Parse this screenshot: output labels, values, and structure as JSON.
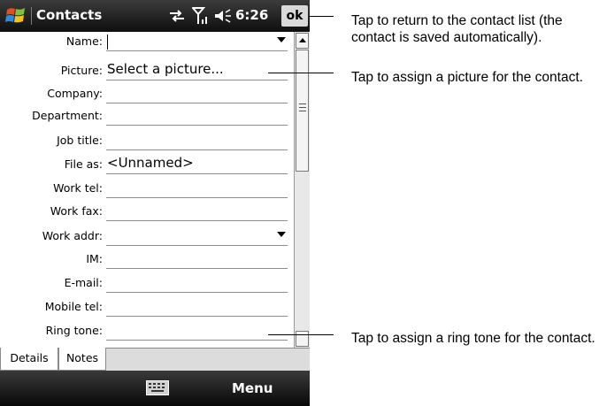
{
  "status_bar": {
    "app_title": "Contacts",
    "clock": "6:26",
    "ok_label": "ok",
    "icons": [
      "windows-start-icon",
      "connectivity-icon",
      "signal-icon",
      "volume-icon"
    ]
  },
  "form": {
    "fields": [
      {
        "label": "Name:",
        "value": "",
        "dropdown": true
      },
      {
        "label": "Picture:",
        "value": "Select a picture..."
      },
      {
        "label": "Company:",
        "value": ""
      },
      {
        "label": "Department:",
        "value": ""
      },
      {
        "label": "Job title:",
        "value": ""
      },
      {
        "label": "File as:",
        "value": "<Unnamed>"
      },
      {
        "label": "Work tel:",
        "value": ""
      },
      {
        "label": "Work fax:",
        "value": ""
      },
      {
        "label": "Work addr:",
        "value": "",
        "dropdown": true
      },
      {
        "label": "IM:",
        "value": ""
      },
      {
        "label": "E-mail:",
        "value": ""
      },
      {
        "label": "Mobile tel:",
        "value": ""
      },
      {
        "label": "Ring tone:",
        "value": ""
      }
    ]
  },
  "tabs": [
    {
      "label": "Details",
      "selected": true
    },
    {
      "label": "Notes",
      "selected": false
    }
  ],
  "softkeys": {
    "input_icon": "keyboard-icon",
    "right_label": "Menu"
  },
  "callouts": [
    {
      "text": "Tap to return to the contact list (the contact is saved automatically)."
    },
    {
      "text": "Tap to assign a picture for the contact."
    },
    {
      "text": "Tap to assign a ring tone for the contact."
    }
  ]
}
